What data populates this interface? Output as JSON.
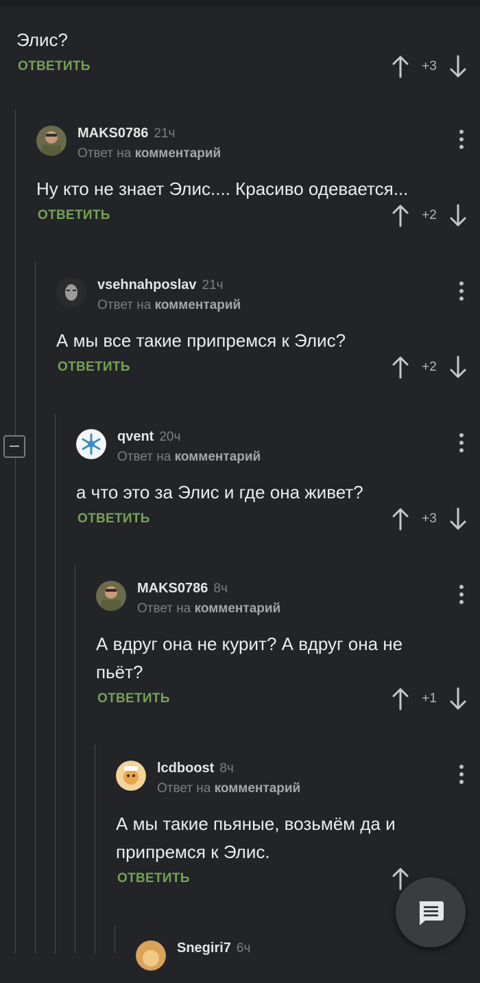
{
  "top_comment": {
    "text": "Элис?",
    "reply_label": "ОТВЕТИТЬ",
    "score": "+3"
  },
  "comments": [
    {
      "author": "MAKS0786",
      "time": "21ч",
      "reply_to_prefix": "Ответ на",
      "reply_to_link": "комментарий",
      "text_lines": [
        "Ну кто не знает Элис.... Красиво одевается..."
      ],
      "reply_label": "ОТВЕТИТЬ",
      "score": "+2",
      "avatar": "man-portrait"
    },
    {
      "author": "vsehnahposlav",
      "time": "21ч",
      "reply_to_prefix": "Ответ на",
      "reply_to_link": "комментарий",
      "text_lines": [
        "А мы все такие припремся к Элис?"
      ],
      "reply_label": "ОТВЕТИТЬ",
      "score": "+2",
      "avatar": "dark-face"
    },
    {
      "author": "qvent",
      "time": "20ч",
      "reply_to_prefix": "Ответ на",
      "reply_to_link": "комментарий",
      "text_lines": [
        "а что это за Элис и где она живет?"
      ],
      "reply_label": "ОТВЕТИТЬ",
      "score": "+3",
      "avatar": "snowflake"
    },
    {
      "author": "MAKS0786",
      "time": "8ч",
      "reply_to_prefix": "Ответ на",
      "reply_to_link": "комментарий",
      "text_lines": [
        "А вдруг она не курит? А вдруг она не",
        "пьёт?"
      ],
      "reply_label": "ОТВЕТИТЬ",
      "score": "+1",
      "avatar": "man-portrait"
    },
    {
      "author": "lcdboost",
      "time": "8ч",
      "reply_to_prefix": "Ответ на",
      "reply_to_link": "комментарий",
      "text_lines": [
        "А мы такие пьяные, возьмём да и",
        "припремся к Элис."
      ],
      "reply_label": "ОТВЕТИТЬ",
      "score": "",
      "avatar": "cartoon"
    },
    {
      "author": "Snegiri7",
      "time": "6ч",
      "avatar": "cartoon"
    }
  ],
  "icons": {
    "upvote": "arrow-up-icon",
    "downvote": "arrow-down-icon",
    "more": "more-vertical-icon",
    "collapse": "minus-square-icon",
    "fab": "comment-icon"
  },
  "colors": {
    "background": "#222427",
    "reply": "#75a356",
    "muted": "#7d7f83"
  }
}
